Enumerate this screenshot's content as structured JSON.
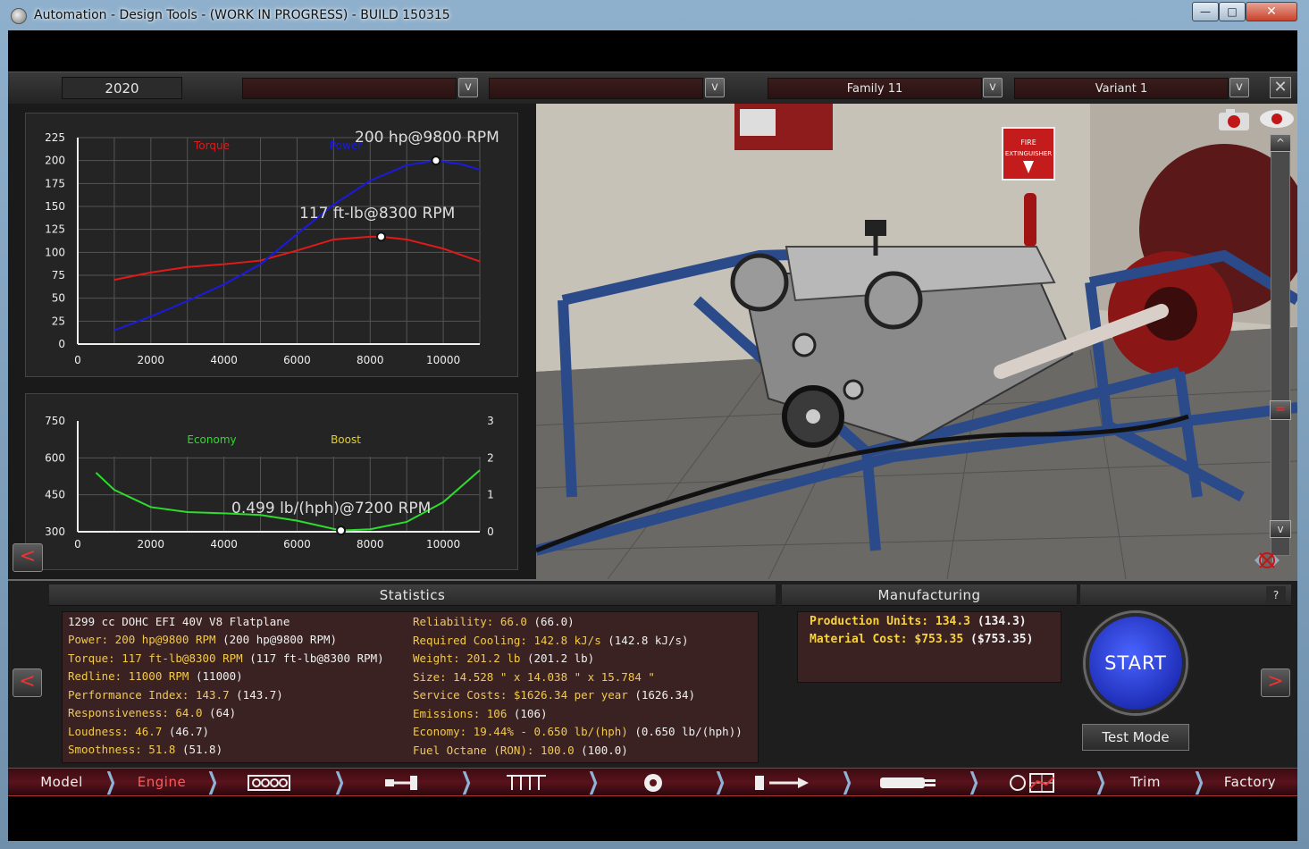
{
  "window": {
    "title": "Automation - Design Tools - (WORK IN PROGRESS) - BUILD 150315",
    "minimize": "—",
    "maximize": "□",
    "close": "✕"
  },
  "topbar": {
    "year": "2020",
    "dropdown1": "",
    "dropdown2": "",
    "family": "Family 11",
    "variant": "Variant 1",
    "dropdown_glyph": "v",
    "close_glyph": "✕"
  },
  "power_chart": {
    "torque_label": "Torque",
    "power_label": "Power",
    "power_peak_label": "200 hp@9800 RPM",
    "torque_peak_label": "117 ft-lb@8300 RPM",
    "y_ticks": [
      "225",
      "200",
      "175",
      "150",
      "125",
      "100",
      "75",
      "50",
      "25",
      "0"
    ],
    "x_ticks": [
      "0",
      "2000",
      "4000",
      "6000",
      "8000",
      "10000"
    ],
    "colors": {
      "torque": "#e01a1a",
      "power": "#1a1ae0"
    }
  },
  "economy_chart": {
    "economy_label": "Economy",
    "boost_label": "Boost",
    "economy_peak_label": "0.499 lb/(hph)@7200 RPM",
    "y_left_ticks": [
      "750",
      "600",
      "450",
      "300"
    ],
    "y_right_ticks": [
      "3",
      "2",
      "1",
      "0"
    ],
    "x_ticks": [
      "0",
      "2000",
      "4000",
      "6000",
      "8000",
      "10000"
    ],
    "colors": {
      "economy": "#2ddc2d",
      "boost": "#e6d020"
    }
  },
  "chart_data": [
    {
      "type": "line",
      "title": "",
      "xlabel": "",
      "ylabel": "",
      "xlim": [
        0,
        11000
      ],
      "ylim": [
        0,
        225
      ],
      "series": [
        {
          "name": "Torque",
          "x": [
            1000,
            2000,
            3000,
            4000,
            5000,
            6000,
            7000,
            8000,
            8300,
            9000,
            10000,
            11000
          ],
          "values": [
            70,
            78,
            84,
            87,
            91,
            102,
            114,
            117,
            117,
            114,
            104,
            90
          ]
        },
        {
          "name": "Power",
          "x": [
            1000,
            2000,
            3000,
            4000,
            5000,
            6000,
            7000,
            8000,
            9000,
            9800,
            10500,
            11000
          ],
          "values": [
            15,
            30,
            47,
            65,
            87,
            120,
            152,
            178,
            195,
            200,
            196,
            190
          ]
        }
      ]
    },
    {
      "type": "line",
      "title": "",
      "xlabel": "",
      "ylabel": "",
      "xlim": [
        0,
        11000
      ],
      "ylim": [
        300,
        750
      ],
      "series": [
        {
          "name": "Economy",
          "x": [
            500,
            1000,
            2000,
            3000,
            4000,
            5000,
            6000,
            7200,
            8000,
            9000,
            10000,
            11000
          ],
          "values": [
            540,
            470,
            400,
            380,
            375,
            368,
            345,
            305,
            310,
            340,
            420,
            550
          ]
        },
        {
          "name": "Boost",
          "x": [],
          "values": []
        }
      ]
    }
  ],
  "statistics": {
    "header": "Statistics",
    "engine": "1299 cc DOHC EFI 40V V8 Flatplane",
    "left": [
      {
        "k": "Power: 200 hp@9800 RPM",
        "v": " (200 hp@9800 RPM)"
      },
      {
        "k": "Torque: 117 ft-lb@8300 RPM",
        "v": " (117 ft-lb@8300 RPM)"
      },
      {
        "k": "Redline: 11000 RPM",
        "v": " (11000)"
      },
      {
        "k": "Performance Index: 143.7",
        "v": " (143.7)"
      },
      {
        "k": "Responsiveness: 64.0",
        "v": " (64)"
      },
      {
        "k": "Loudness: 46.7",
        "v": " (46.7)"
      },
      {
        "k": "Smoothness: 51.8",
        "v": " (51.8)"
      }
    ],
    "right": [
      {
        "k": "Reliability: 66.0",
        "v": " (66.0)"
      },
      {
        "k": "Required Cooling: 142.8 kJ/s",
        "v": " (142.8 kJ/s)"
      },
      {
        "k": "Weight: 201.2 lb",
        "v": " (201.2 lb)"
      },
      {
        "k": "Size: 14.528 \" x 14.038 \" x 15.784 \"",
        "v": ""
      },
      {
        "k": "Service Costs: $1626.34 per year",
        "v": " (1626.34)"
      },
      {
        "k": "Emissions: 106",
        "v": " (106)"
      },
      {
        "k": "Economy: 19.44% - 0.650 lb/(hph)",
        "v": " (0.650 lb/(hph))"
      },
      {
        "k": "Fuel Octane (RON): 100.0",
        "v": " (100.0)"
      }
    ]
  },
  "manufacturing": {
    "header": "Manufacturing",
    "help": "?",
    "rows": [
      {
        "k": "Production Units: 134.3",
        "v": " (134.3)"
      },
      {
        "k": "Material Cost: $753.35",
        "v": " ($753.35)"
      }
    ]
  },
  "actions": {
    "start": "START",
    "test_mode": "Test Mode",
    "prev": "<",
    "next": ">"
  },
  "tabs": {
    "model": "Model",
    "engine": "Engine",
    "trim": "Trim",
    "factory": "Factory",
    "icon_tabs": [
      "block-icon",
      "crank-icon",
      "heads-icon",
      "turbo-icon",
      "fuel-icon",
      "exhaust-icon",
      "tuning-icon"
    ]
  },
  "viewport": {
    "poster_text": "FIRE EXTINGUISHER"
  }
}
